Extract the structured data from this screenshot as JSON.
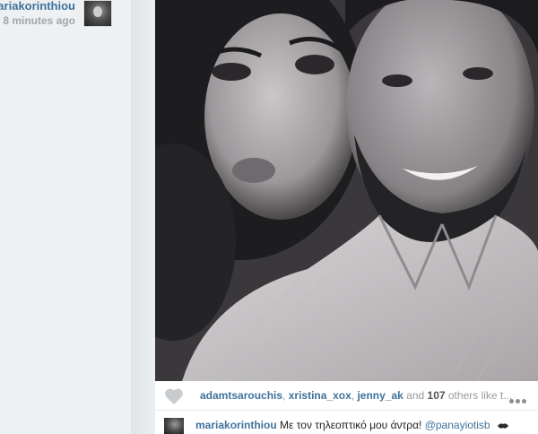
{
  "post": {
    "username": "mariakorinthiou",
    "timestamp": "8 minutes ago"
  },
  "photo": {
    "subject": "selfie-photo"
  },
  "likes": {
    "likers": [
      "adamtsarouchis",
      "xristina_xox",
      "jenny_ak"
    ],
    "sep1": ", ",
    "sep2": ", ",
    "and": " and ",
    "count": "107",
    "others_text": " others like t..."
  },
  "caption": {
    "username": "mariakorinthiou",
    "text": " Με τον τηλεοπτικό μου άντρα! ",
    "mention": "@panayiotisb"
  },
  "icons": {
    "like": "heart-icon",
    "more": "ellipsis-icon",
    "emoji": "kiss-lips-icon"
  }
}
